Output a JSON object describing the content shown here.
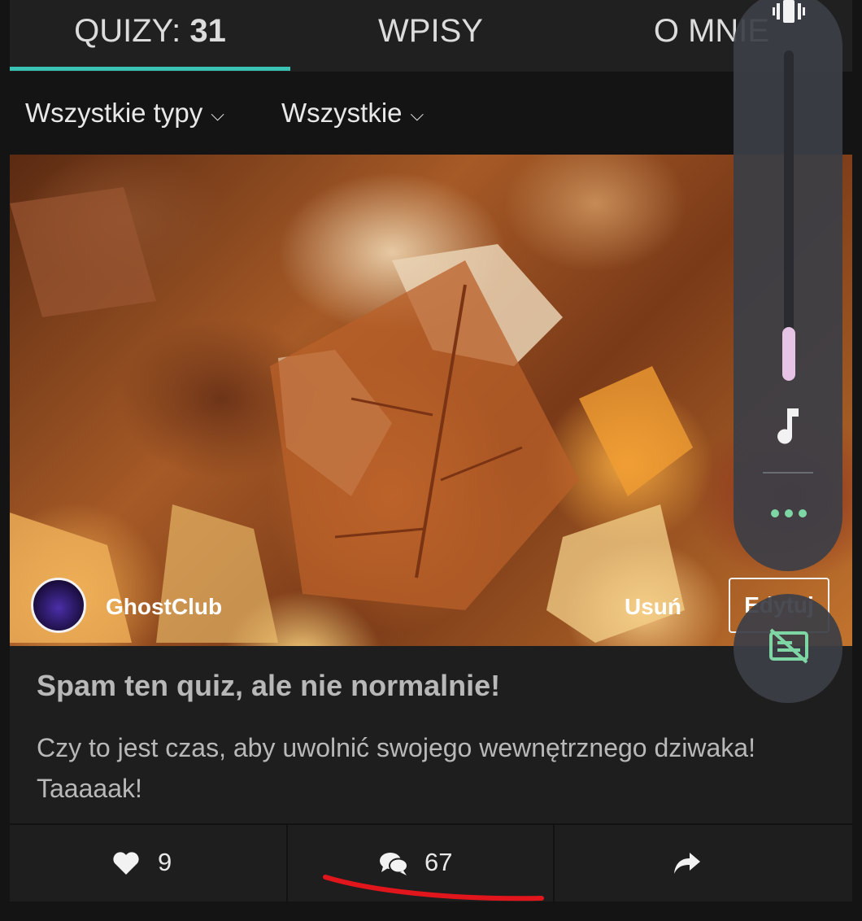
{
  "tabs": [
    {
      "label": "QUIZY: ",
      "count": "31",
      "active": true
    },
    {
      "label": "WPISY",
      "active": false
    },
    {
      "label": "O MNIE",
      "active": false
    }
  ],
  "filters": [
    {
      "label": "Wszystkie typy",
      "icon": "chevron-down-icon"
    },
    {
      "label": "Wszystkie",
      "icon": "chevron-down-icon"
    }
  ],
  "quiz": {
    "author": "GhostClub",
    "delete_label": "Usuń",
    "edit_label": "Edytuj",
    "title": "Spam ten quiz, ale nie normalnie!",
    "description": "Czy to jest czas, aby uwolnić swojego wewnętrznego dziwaka! Taaaaak!",
    "likes": "9",
    "comments": "67"
  },
  "colors": {
    "accent": "#3ac2b5",
    "annotation": "#e0161c",
    "volume_fill": "#e7c3e6",
    "caption_icon": "#7ed6a4"
  },
  "volume_overlay": {
    "level": 0.16,
    "icons": [
      "vibrate-icon",
      "music-note-icon",
      "more-dots-icon",
      "captions-off-icon"
    ]
  }
}
